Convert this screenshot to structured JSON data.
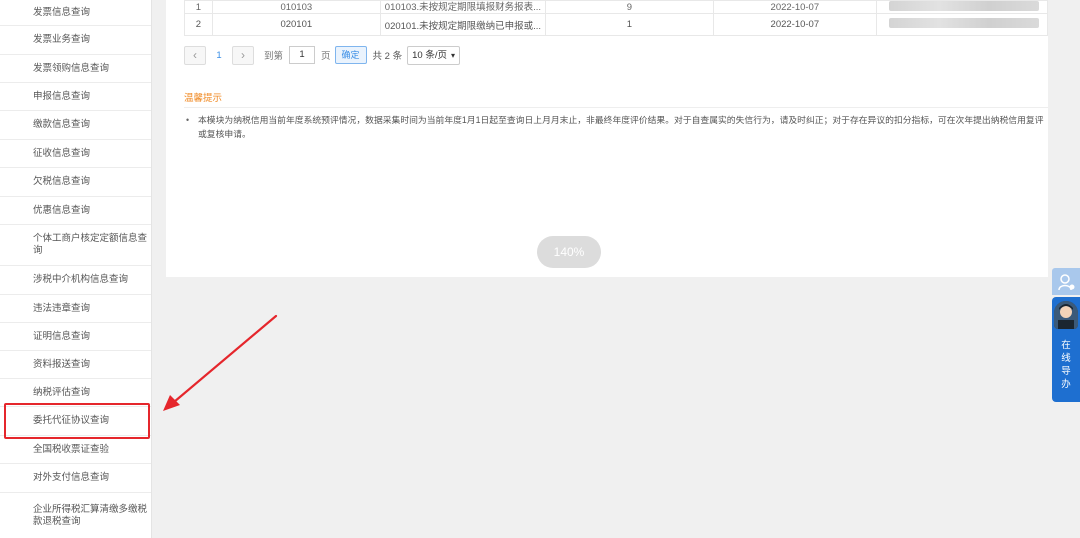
{
  "sidebar": {
    "items": [
      {
        "label": "发票信息查询"
      },
      {
        "label": "发票业务查询"
      },
      {
        "label": "发票领购信息查询"
      },
      {
        "label": "申报信息查询"
      },
      {
        "label": "缴款信息查询"
      },
      {
        "label": "征收信息查询"
      },
      {
        "label": "欠税信息查询"
      },
      {
        "label": "优惠信息查询"
      },
      {
        "label": "个体工商户核定定额信息查询"
      },
      {
        "label": "涉税中介机构信息查询"
      },
      {
        "label": "违法违章查询"
      },
      {
        "label": "证明信息查询"
      },
      {
        "label": "资料报送查询"
      },
      {
        "label": "纳税评估查询"
      },
      {
        "label": "委托代征协议查询"
      },
      {
        "label": "全国税收票证查验"
      },
      {
        "label": "对外支付信息查询"
      },
      {
        "label": "企业所得税汇算清缴多缴税款退税查询"
      }
    ]
  },
  "table": {
    "rows": [
      {
        "no": "1",
        "code": "010103",
        "desc": "010103.未按规定期限填报财务报表...",
        "score": "9",
        "date": "2022-10-07"
      },
      {
        "no": "2",
        "code": "020101",
        "desc": "020101.未按规定期限缴纳已申报或...",
        "score": "1",
        "date": "2022-10-07"
      }
    ]
  },
  "pager": {
    "prev_icon": "chevron-left-icon",
    "page": "1",
    "next_icon": "chevron-right-icon",
    "goto_label": "到第",
    "page_input": "1",
    "page_unit": "页",
    "confirm": "确定",
    "total": "共 2 条",
    "page_size": "10 条/页"
  },
  "tips": {
    "title": "温馨提示",
    "body": "本模块为纳税信用当前年度系统预评情况，数据采集时间为当前年度1月1日起至查询日上月月末止，非最终年度评价结果。对于自查属实的失信行为，请及时纠正；对于存在异议的扣分指标，可在次年提出纳税信用复评或复核申请。"
  },
  "zoom": "140%",
  "float_widget": {
    "label": "在线导办"
  },
  "colors": {
    "highlight": "#e5262c",
    "accent": "#3a8ee6",
    "tip_title": "#f08a24",
    "widget": "#1e6fd0"
  }
}
